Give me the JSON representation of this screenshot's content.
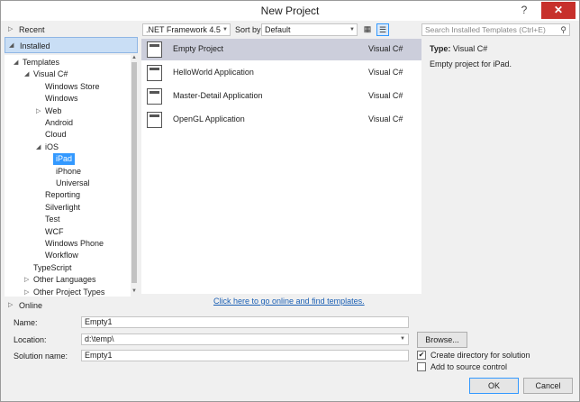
{
  "window": {
    "title": "New Project",
    "help": "?",
    "close": "✕"
  },
  "left": {
    "recent": "Recent",
    "installed": "Installed",
    "online": "Online",
    "tree": [
      {
        "label": "Templates",
        "depth": 0,
        "expander": "◢"
      },
      {
        "label": "Visual C#",
        "depth": 1,
        "expander": "◢"
      },
      {
        "label": "Windows Store",
        "depth": 2,
        "expander": ""
      },
      {
        "label": "Windows",
        "depth": 2,
        "expander": ""
      },
      {
        "label": "Web",
        "depth": 2,
        "expander": "▷"
      },
      {
        "label": "Android",
        "depth": 2,
        "expander": ""
      },
      {
        "label": "Cloud",
        "depth": 2,
        "expander": ""
      },
      {
        "label": "iOS",
        "depth": 2,
        "expander": "◢"
      },
      {
        "label": "iPad",
        "depth": 3,
        "expander": "",
        "selected": true
      },
      {
        "label": "iPhone",
        "depth": 3,
        "expander": ""
      },
      {
        "label": "Universal",
        "depth": 3,
        "expander": ""
      },
      {
        "label": "Reporting",
        "depth": 2,
        "expander": ""
      },
      {
        "label": "Silverlight",
        "depth": 2,
        "expander": ""
      },
      {
        "label": "Test",
        "depth": 2,
        "expander": ""
      },
      {
        "label": "WCF",
        "depth": 2,
        "expander": ""
      },
      {
        "label": "Windows Phone",
        "depth": 2,
        "expander": ""
      },
      {
        "label": "Workflow",
        "depth": 2,
        "expander": ""
      },
      {
        "label": "TypeScript",
        "depth": 1,
        "expander": ""
      },
      {
        "label": "Other Languages",
        "depth": 1,
        "expander": "▷"
      },
      {
        "label": "Other Project Types",
        "depth": 1,
        "expander": "▷"
      }
    ]
  },
  "toolbar": {
    "framework": ".NET Framework 4.5",
    "sort_label": "Sort by:",
    "sort_value": "Default",
    "search_placeholder": "Search Installed Templates (Ctrl+E)"
  },
  "templates": [
    {
      "name": "Empty Project",
      "lang": "Visual C#",
      "selected": true
    },
    {
      "name": "HelloWorld Application",
      "lang": "Visual C#"
    },
    {
      "name": "Master-Detail Application",
      "lang": "Visual C#"
    },
    {
      "name": "OpenGL Application",
      "lang": "Visual C#"
    }
  ],
  "details": {
    "type_label": "Type:",
    "type_value": "Visual C#",
    "description": "Empty project for iPad."
  },
  "online_link": "Click here to go online and find templates.",
  "form": {
    "name_label": "Name:",
    "name_value": "Empty1",
    "location_label": "Location:",
    "location_value": "d:\\temp\\",
    "solution_label": "Solution name:",
    "solution_value": "Empty1",
    "browse": "Browse...",
    "create_dir": "Create directory for solution",
    "create_dir_checked": true,
    "add_source": "Add to source control",
    "add_source_checked": false,
    "ok": "OK",
    "cancel": "Cancel"
  }
}
